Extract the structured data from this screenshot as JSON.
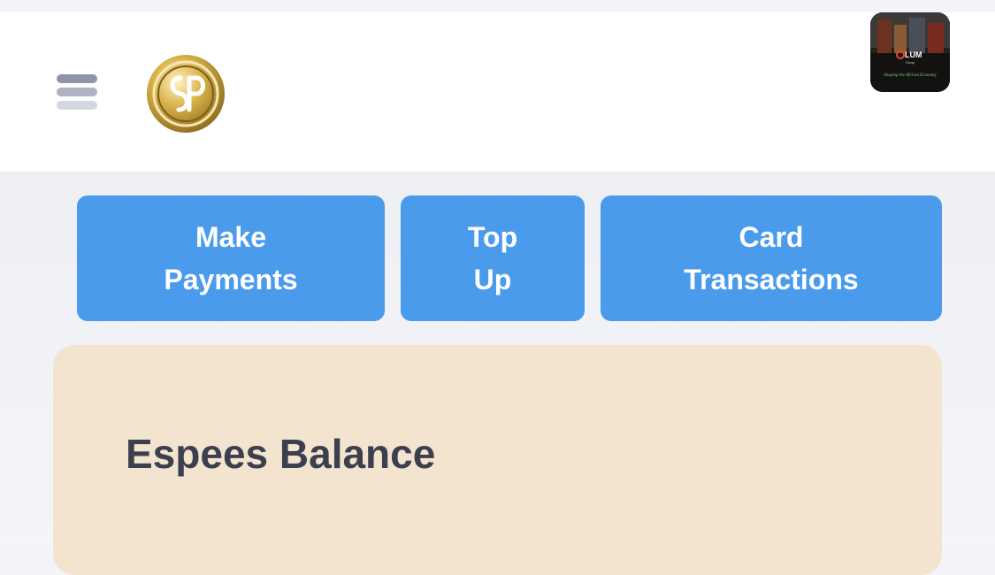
{
  "header": {
    "menu_icon": "hamburger-menu-icon",
    "logo": "espees-coin-logo",
    "avatar": {
      "brand": "OLUM",
      "sub": "Group",
      "tagline": "Shaping the African Economy"
    }
  },
  "actions": [
    {
      "line1": "Make",
      "line2": "Payments"
    },
    {
      "line1": "Top",
      "line2": "Up"
    },
    {
      "line1": "Card",
      "line2": "Transactions"
    }
  ],
  "balance": {
    "title": "Espees Balance"
  },
  "colors": {
    "action_button": "#4a9bec",
    "balance_card": "#f2e4ce",
    "text_dark": "#3c3f4e"
  }
}
